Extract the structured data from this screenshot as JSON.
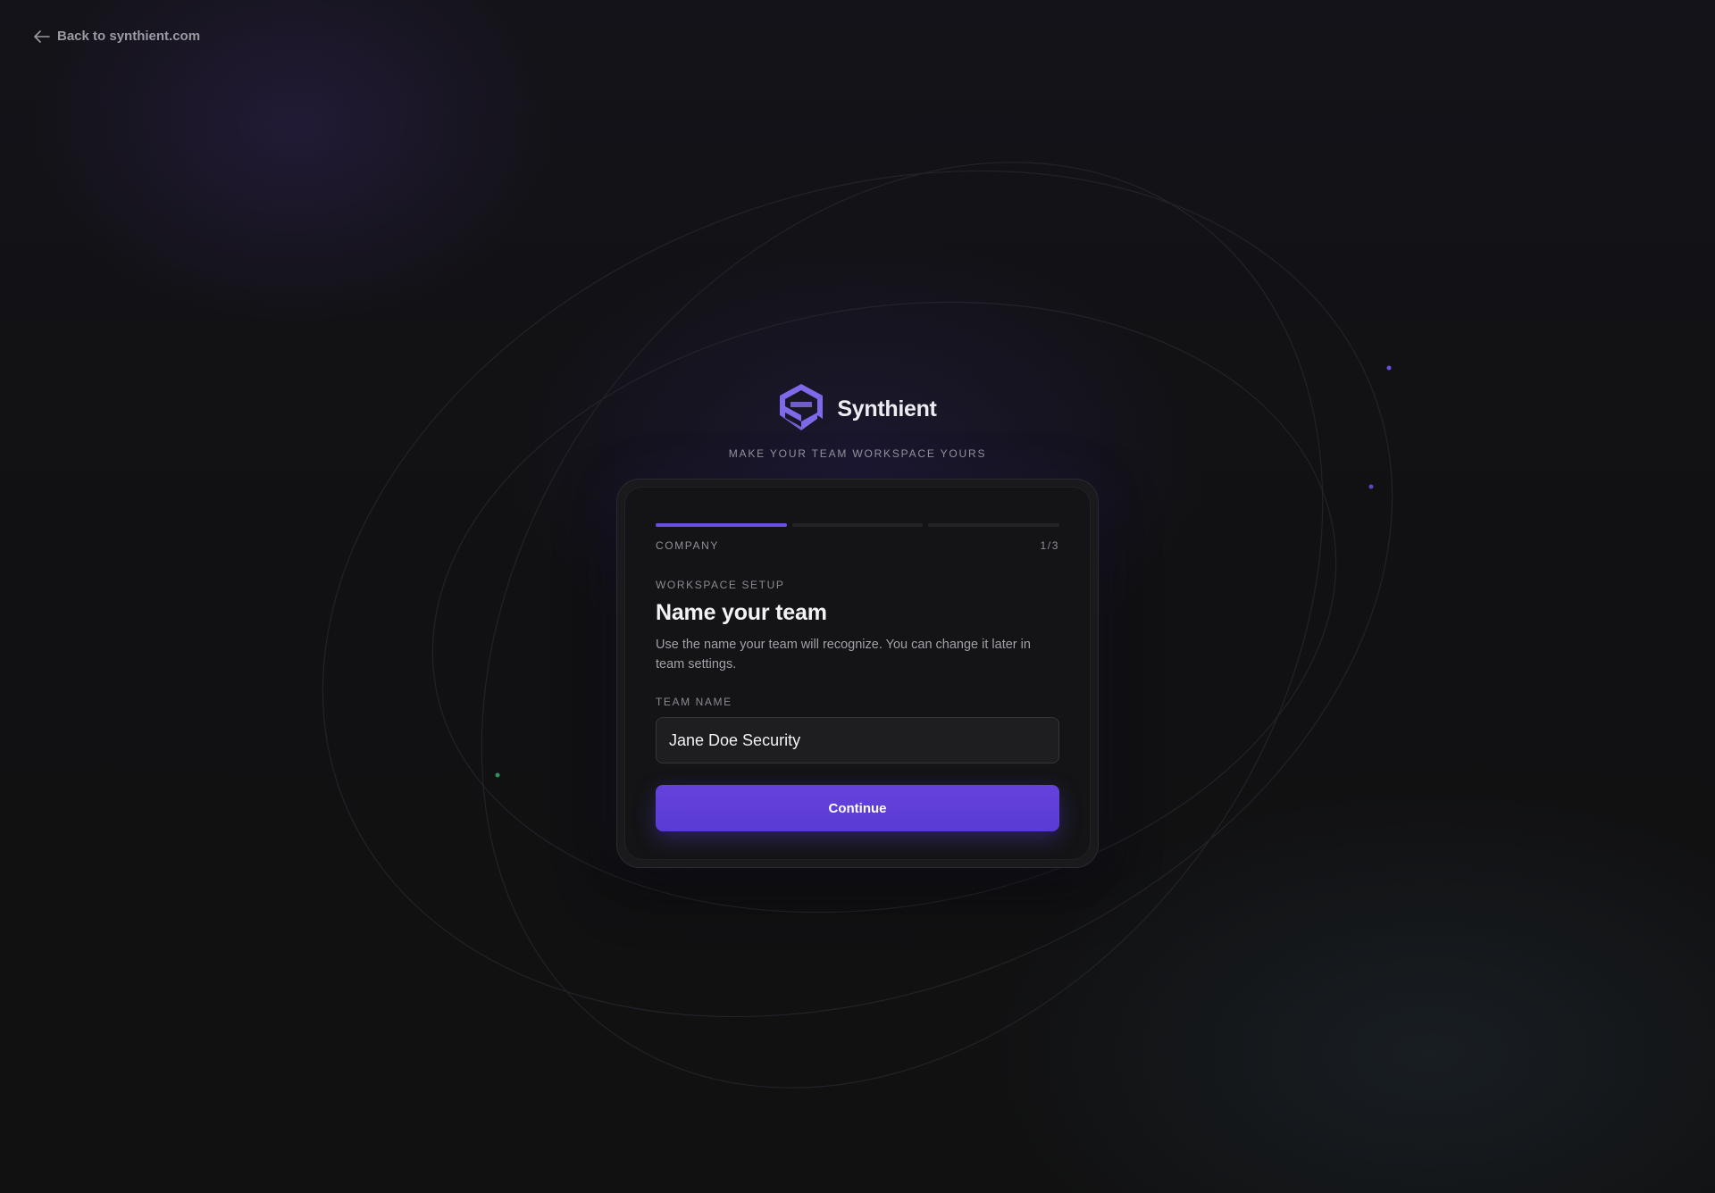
{
  "header": {
    "back_link_label": "Back to synthient.com",
    "back_icon": "arrow-left-icon"
  },
  "brand": {
    "name": "Synthient",
    "logo_icon": "synthient-logo-icon",
    "tagline": "MAKE YOUR TEAM WORKSPACE YOURS",
    "accent_color": "#6b4fe0"
  },
  "wizard": {
    "progress": {
      "current_step": 1,
      "total_steps": 3
    },
    "step_label": "COMPANY",
    "step_counter": "1/3",
    "eyebrow": "WORKSPACE SETUP",
    "title": "Name your team",
    "description": "Use the name your team will recognize. You can change it later in team settings.",
    "field_label": "TEAM NAME",
    "team_name_value": "Jane Doe Security",
    "continue_label": "Continue"
  }
}
